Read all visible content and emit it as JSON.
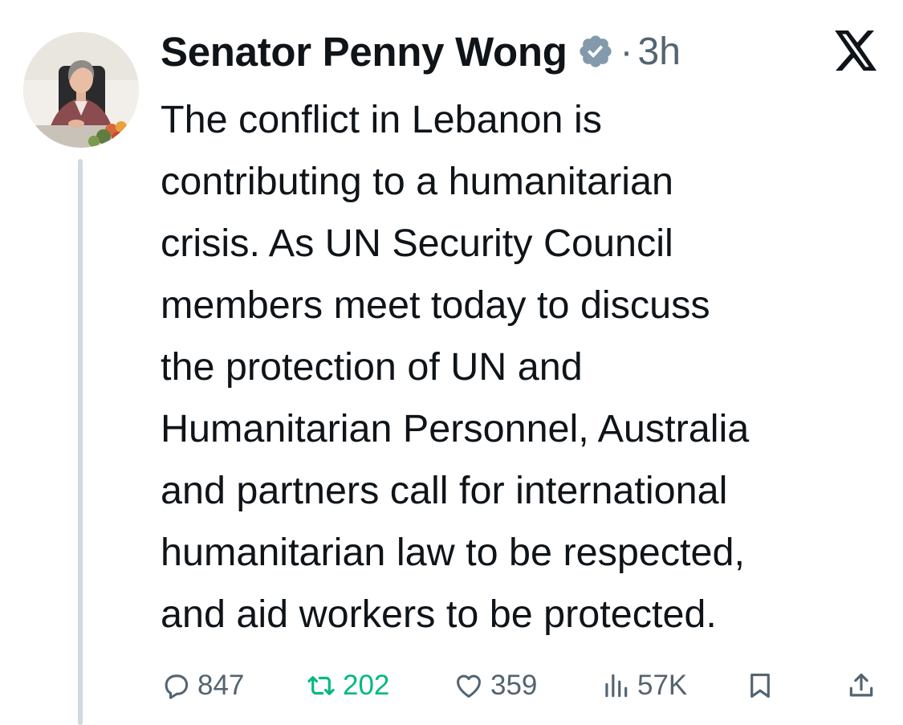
{
  "author": {
    "display_name": "Senator Penny Wong",
    "verified": true,
    "separator": "·",
    "time_ago": "3h"
  },
  "tweet": {
    "lines": [
      "The conflict in Lebanon is",
      "contributing to a humanitarian",
      "crisis. As UN Security Council",
      "members meet today to discuss",
      "the protection of UN and",
      "Humanitarian Personnel, Australia",
      "and partners call for international",
      "humanitarian law to be respected,",
      "and aid workers to be protected."
    ]
  },
  "actions": {
    "replies": "847",
    "reposts": "202",
    "likes": "359",
    "views": "57K"
  },
  "icons": {
    "verified": "verified-badge-icon",
    "platform": "x-logo-icon",
    "reply": "reply-icon",
    "repost": "repost-icon",
    "like": "heart-icon",
    "views": "views-chart-icon",
    "bookmark": "bookmark-icon",
    "share": "share-icon"
  },
  "colors": {
    "text": "#0f1419",
    "secondary": "#536471",
    "repost_active": "#00ba7c",
    "verified_badge": "#829aab",
    "thread_line": "#cfd9de"
  }
}
